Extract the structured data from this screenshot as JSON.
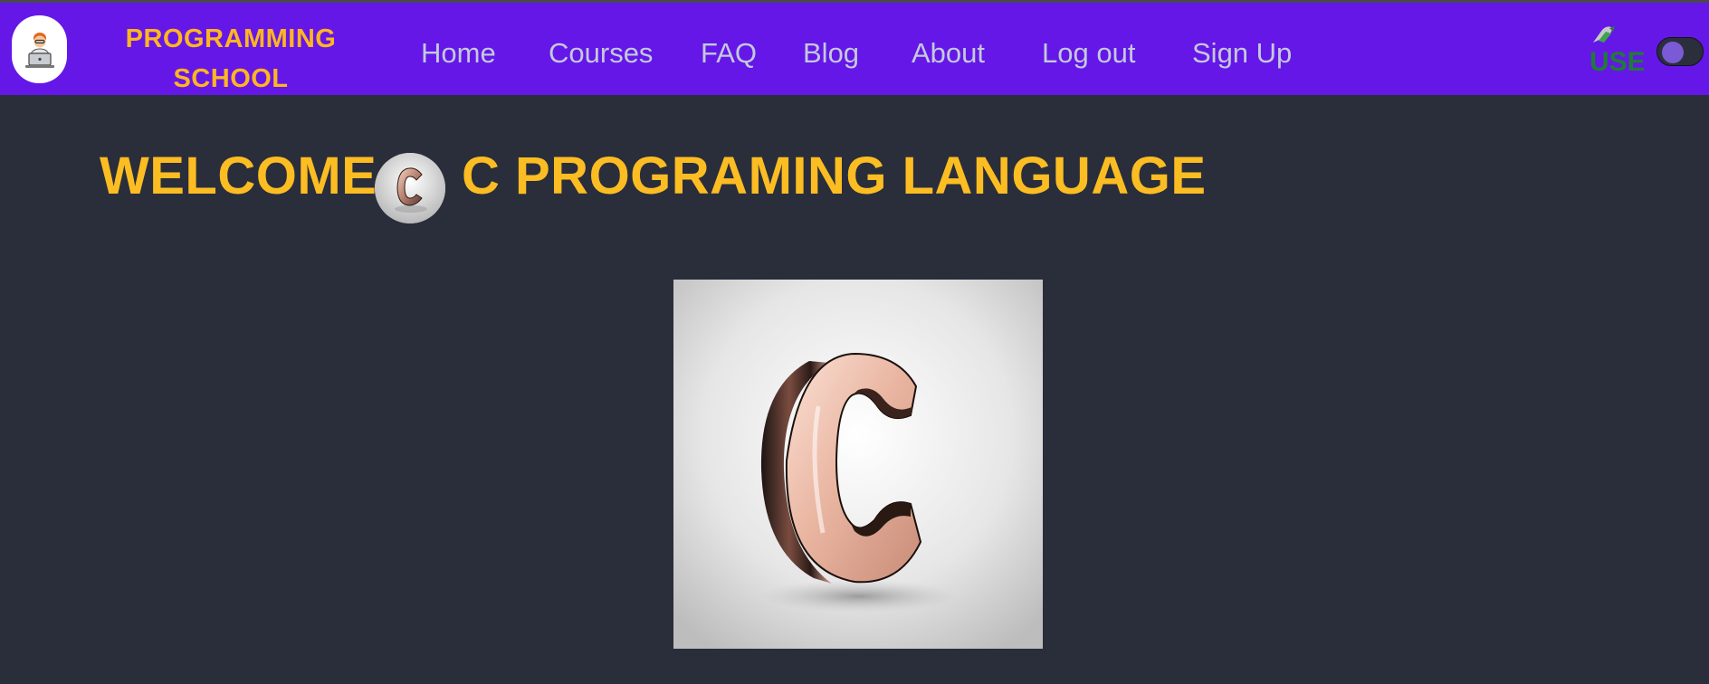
{
  "brand": {
    "line1": "PROGRAMMING",
    "line2": "SCHOOL",
    "color": "#ffb521",
    "logo_icon": "programmer-at-laptop-icon"
  },
  "nav": {
    "background": "#6517e8",
    "items": [
      {
        "label": "Home"
      },
      {
        "label": "Courses"
      },
      {
        "label": "FAQ"
      },
      {
        "label": "Blog"
      },
      {
        "label": "About"
      },
      {
        "label": "Log out"
      },
      {
        "label": "Sign Up"
      }
    ],
    "user_label": "USER",
    "user_icon": "user-avatar-broken-image-icon",
    "theme_toggle": {
      "icon": "dark-mode-toggle",
      "state": "off"
    }
  },
  "main": {
    "heading_left": "WELCOME",
    "heading_right": "C PROGRAMING LANGUAGE",
    "heading_color": "#fcbd23",
    "heading_badge_icon": "c-letter-badge-icon",
    "hero_image": "rose-gold-3d-letter-c-icon",
    "background": "#2a2e3b"
  }
}
